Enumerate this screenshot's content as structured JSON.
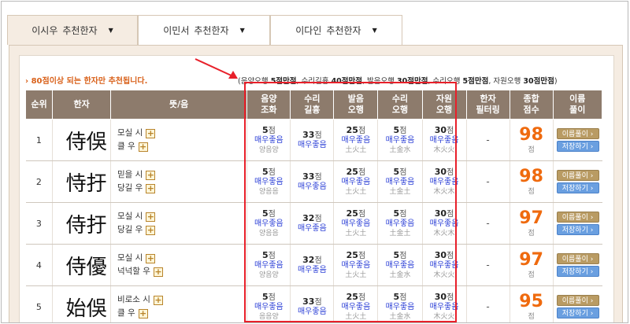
{
  "tabs": [
    {
      "name": "이시우",
      "label": "추천한자",
      "active": true
    },
    {
      "name": "이민서",
      "label": "추천한자",
      "active": false
    },
    {
      "name": "이다인",
      "label": "추천한자",
      "active": false
    }
  ],
  "notice": "› 80점이상 되는 한자만 추천됩니다.",
  "criteria": [
    {
      "label": "(음양오행 ",
      "value": "5점만점"
    },
    {
      "label": ", 수리길흉 ",
      "value": "40점만점"
    },
    {
      "label": ", 발음오행 ",
      "value": "30점만점"
    },
    {
      "label": ", 수리오행 ",
      "value": "5점만점"
    },
    {
      "label": ", 자원오행 ",
      "value": "30점만점"
    },
    {
      "label": ")",
      "value": ""
    }
  ],
  "headers": {
    "rank": "순위",
    "hanja": "한자",
    "meaning": "뜻/음",
    "yinyang": [
      "음양",
      "조화"
    ],
    "suri": [
      "수리",
      "길흉"
    ],
    "pronun": [
      "발음",
      "오행"
    ],
    "suri_ohaeng": [
      "수리",
      "오행"
    ],
    "jawon": [
      "자원",
      "오행"
    ],
    "filter": [
      "한자",
      "필터링"
    ],
    "total": [
      "종합",
      "점수"
    ],
    "name_interp": [
      "이름",
      "풀이"
    ]
  },
  "rows": [
    {
      "rank": "1",
      "hanja": "侍俁",
      "m1": "모실 시",
      "m2": "클 우",
      "s1": "5",
      "s1sub": "양음양",
      "s2": "33",
      "s2sub": "",
      "s3": "25",
      "s3sub": "土火土",
      "s4": "5",
      "s4sub": "土金水",
      "s5": "30",
      "s5sub": "木火火",
      "filter": "-",
      "total": "98"
    },
    {
      "rank": "2",
      "hanja": "恃扜",
      "m1": "믿을 시",
      "m2": "당길 우",
      "s1": "5",
      "s1sub": "양음음",
      "s2": "33",
      "s2sub": "",
      "s3": "25",
      "s3sub": "土火土",
      "s4": "5",
      "s4sub": "土金土",
      "s5": "30",
      "s5sub": "木火木",
      "filter": "-",
      "total": "98"
    },
    {
      "rank": "3",
      "hanja": "侍扜",
      "m1": "모실 시",
      "m2": "당길 우",
      "s1": "5",
      "s1sub": "양음음",
      "s2": "32",
      "s2sub": "",
      "s3": "25",
      "s3sub": "土火土",
      "s4": "5",
      "s4sub": "土金土",
      "s5": "30",
      "s5sub": "木火木",
      "filter": "-",
      "total": "97"
    },
    {
      "rank": "4",
      "hanja": "侍優",
      "m1": "모실 시",
      "m2": "넉넉할 우",
      "s1": "5",
      "s1sub": "양음양",
      "s2": "32",
      "s2sub": "",
      "s3": "25",
      "s3sub": "土火土",
      "s4": "5",
      "s4sub": "土金水",
      "s5": "30",
      "s5sub": "木火火",
      "filter": "-",
      "total": "97"
    },
    {
      "rank": "5",
      "hanja": "始俁",
      "m1": "비로소 시",
      "m2": "클 우",
      "s1": "5",
      "s1sub": "음음양",
      "s2": "33",
      "s2sub": "",
      "s3": "25",
      "s3sub": "土火土",
      "s4": "5",
      "s4sub": "土金水",
      "s5": "30",
      "s5sub": "木火火",
      "filter": "-",
      "total": "95"
    }
  ],
  "common": {
    "pt_unit": "점",
    "verdict": "매우좋음",
    "total_unit": "점",
    "btn_interp": "이름풀이 ›",
    "btn_save": "저장하기 ›",
    "plus": "+"
  },
  "colors": {
    "highlight": "#e8202a",
    "total": "#ef6a0e",
    "verdict": "#2b3fd6",
    "header_bg": "#8d7b6c"
  }
}
